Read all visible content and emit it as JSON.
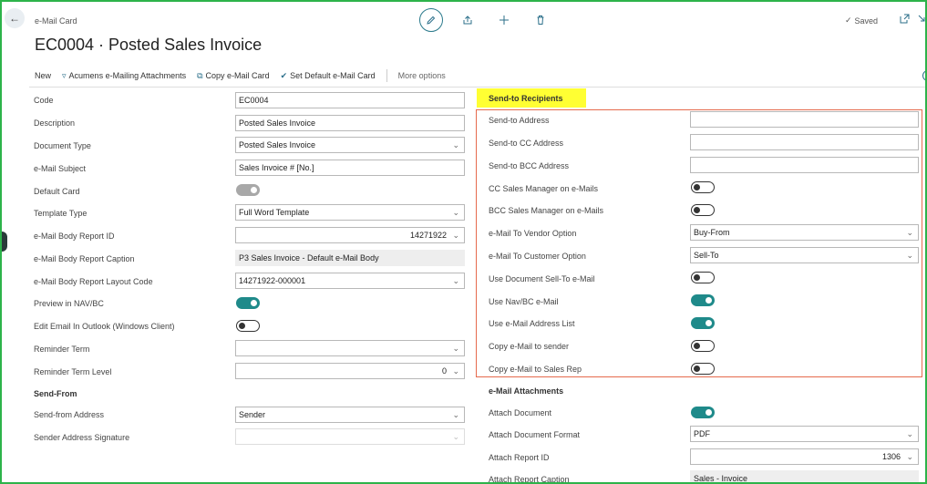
{
  "header": {
    "page_type": "e-Mail Card",
    "title": "EC0004 · Posted Sales Invoice",
    "saved": "Saved"
  },
  "actions": {
    "new": "New",
    "acumens": "Acumens e-Mailing Attachments",
    "copy": "Copy e-Mail Card",
    "set_default": "Set Default e-Mail Card",
    "more": "More options"
  },
  "general": {
    "code": {
      "label": "Code",
      "value": "EC0004"
    },
    "description": {
      "label": "Description",
      "value": "Posted Sales Invoice"
    },
    "document_type": {
      "label": "Document Type",
      "value": "Posted Sales Invoice"
    },
    "subject": {
      "label": "e-Mail Subject",
      "value": "Sales Invoice # [No.]"
    },
    "default_card": {
      "label": "Default Card"
    },
    "template_type": {
      "label": "Template Type",
      "value": "Full Word Template"
    },
    "body_report_id": {
      "label": "e-Mail Body Report ID",
      "value": "14271922"
    },
    "body_report_caption": {
      "label": "e-Mail Body Report Caption",
      "value": "P3 Sales Invoice - Default e-Mail Body"
    },
    "body_layout_code": {
      "label": "e-Mail Body Report Layout Code",
      "value": "14271922-000001"
    },
    "preview": {
      "label": "Preview in NAV/BC"
    },
    "edit_outlook": {
      "label": "Edit Email In Outlook (Windows Client)"
    },
    "reminder_term": {
      "label": "Reminder Term",
      "value": ""
    },
    "reminder_level": {
      "label": "Reminder Term Level",
      "value": "0"
    }
  },
  "send_from": {
    "heading": "Send-From",
    "address": {
      "label": "Send-from Address",
      "value": "Sender"
    },
    "signature": {
      "label": "Sender Address Signature",
      "value": ""
    }
  },
  "recipients": {
    "heading": "Send-to Recipients",
    "send_to": {
      "label": "Send-to Address",
      "value": ""
    },
    "cc": {
      "label": "Send-to CC Address",
      "value": ""
    },
    "bcc": {
      "label": "Send-to BCC Address",
      "value": ""
    },
    "cc_sales_mgr": {
      "label": "CC Sales Manager on e-Mails"
    },
    "bcc_sales_mgr": {
      "label": "BCC Sales Manager on e-Mails"
    },
    "vendor_option": {
      "label": "e-Mail To Vendor Option",
      "value": "Buy-From"
    },
    "customer_option": {
      "label": "e-Mail To Customer Option",
      "value": "Sell-To"
    },
    "use_doc_sellto": {
      "label": "Use Document Sell-To e-Mail"
    },
    "use_nav": {
      "label": "Use Nav/BC e-Mail"
    },
    "use_list": {
      "label": "Use e-Mail Address List"
    },
    "copy_sender": {
      "label": "Copy e-Mail to sender"
    },
    "copy_rep": {
      "label": "Copy e-Mail to Sales Rep"
    }
  },
  "attachments": {
    "heading": "e-Mail  Attachments",
    "attach_doc": {
      "label": "Attach Document"
    },
    "format": {
      "label": "Attach Document Format",
      "value": "PDF"
    },
    "report_id": {
      "label": "Attach Report ID",
      "value": "1306"
    },
    "report_caption": {
      "label": "Attach Report Caption",
      "value": "Sales - Invoice"
    }
  },
  "colors": {
    "accent": "#1f8a8a",
    "highlight": "#ffff33",
    "red_box": "#e66a4d",
    "frame": "#2db34a"
  }
}
